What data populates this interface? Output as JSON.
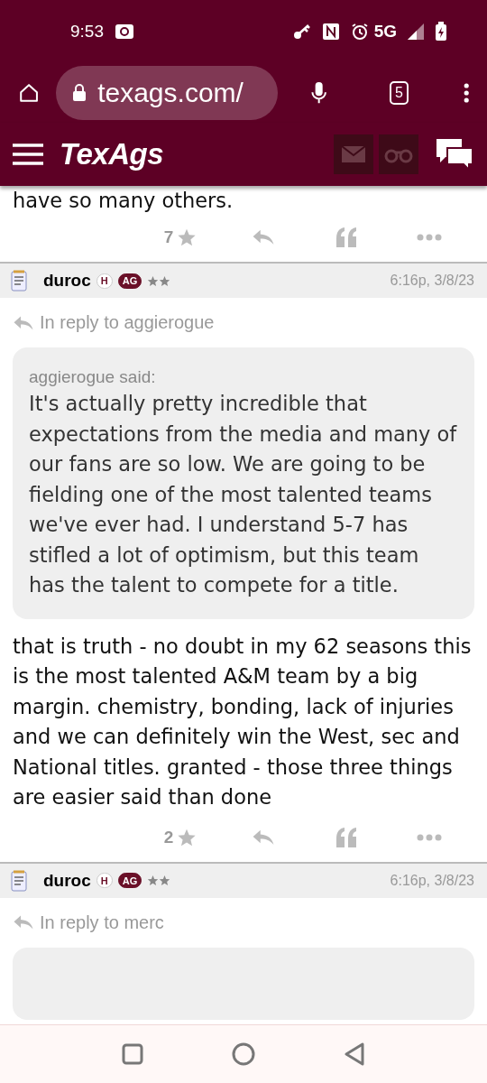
{
  "status_bar": {
    "time": "9:53",
    "network": "5G"
  },
  "browser": {
    "url": "texags.com/",
    "tab_count": "5"
  },
  "site_nav": {
    "brand": "TexAgs"
  },
  "posts": [
    {
      "kind": "tail",
      "body": "have so many others.",
      "likes": "7"
    },
    {
      "kind": "full",
      "author": "duroc",
      "badges": [
        "H",
        "AG"
      ],
      "time": "6:16p, 3/8/23",
      "reply_to": "In reply to aggierogue",
      "quote_author": "aggierogue said:",
      "quote": "It's actually pretty incredible that expectations from the media and many of our fans are so low. We are going to be fielding one of the most talented teams we've ever had. I understand 5-7 has stifled a lot of optimism, but this team has the talent to compete for a title.",
      "body": "that is truth - no doubt in my 62 seasons this is the most talented A&M team by a big margin. chemistry, bonding, lack of injuries and we can definitely win the West, sec and National titles. granted - those three things are easier said than done",
      "likes": "2"
    },
    {
      "kind": "head",
      "author": "duroc",
      "badges": [
        "H",
        "AG"
      ],
      "time": "6:16p, 3/8/23",
      "reply_to": "In reply to merc"
    }
  ]
}
